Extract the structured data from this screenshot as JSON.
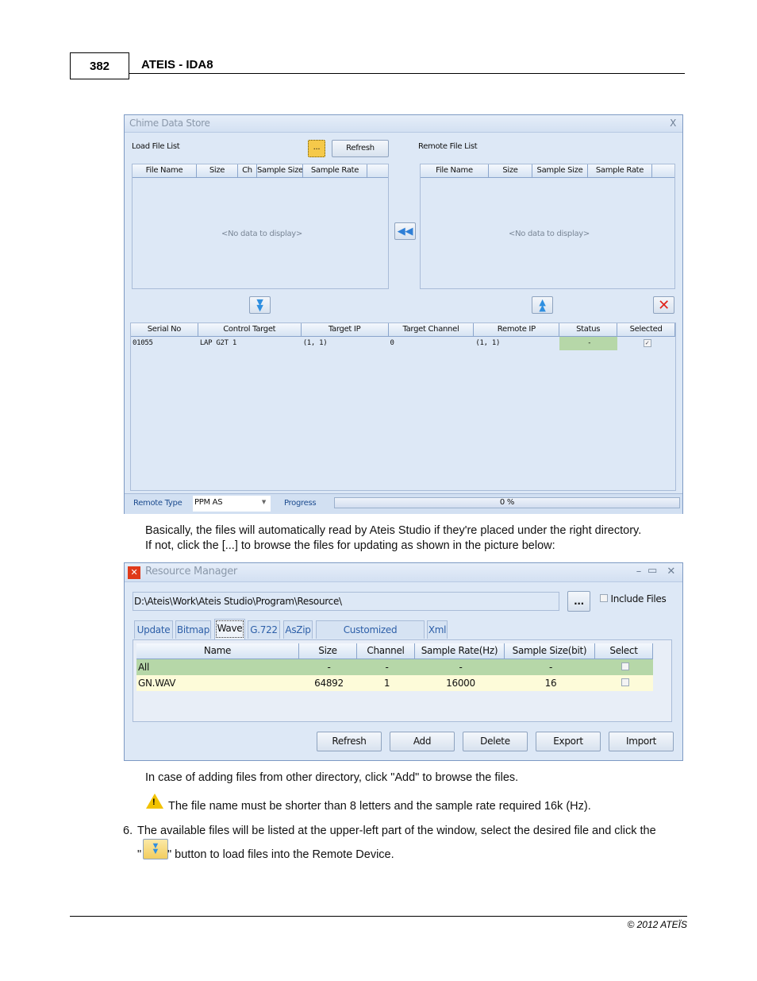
{
  "page": {
    "number": "382",
    "title": "ATEIS - IDA8",
    "copyright": "© 2012 ATEÏS"
  },
  "chime": {
    "title": "Chime Data Store",
    "close": "X",
    "load_label": "Load File List",
    "browse_label": "...",
    "refresh_label": "Refresh",
    "remote_label": "Remote File List",
    "load_columns": [
      "File Name",
      "Size",
      "Ch",
      "Sample Size",
      "Sample Rate"
    ],
    "remote_columns": [
      "File Name",
      "Size",
      "Sample Size",
      "Sample Rate"
    ],
    "no_data": "<No data to display>",
    "device_columns": [
      "Serial No",
      "Control Target",
      "Target IP",
      "Target Channel",
      "Remote IP",
      "Status",
      "Selected"
    ],
    "device_rows": [
      {
        "serial": "01055",
        "control": "LAP G2T 1",
        "target_ip": "(1, 1)",
        "channel": "0",
        "remote_ip": "(1, 1)",
        "status": "-",
        "selected": true
      }
    ],
    "remote_type_label": "Remote Type",
    "remote_type_value": "PPM AS",
    "progress_label": "Progress",
    "progress_text": "0 %",
    "progress_percent": 0,
    "status_color": "#b6d7a8"
  },
  "text1": "Basically, the files will automatically read by Ateis Studio if they're placed under the right directory.",
  "text2": "If not, click the [...] to browse the files for updating as shown in the picture below:",
  "resource": {
    "title": "Resource Manager",
    "path": "D:\\Ateis\\Work\\Ateis Studio\\Program\\Resource\\",
    "browse_label": "...",
    "include_files": "Include Files",
    "tabs": [
      "Update",
      "Bitmap",
      "Wave",
      "G.722",
      "AsZip",
      "Customized Component",
      "Xml"
    ],
    "active_tab": "Wave",
    "columns": [
      "Name",
      "Size",
      "Channel",
      "Sample Rate(Hz)",
      "Sample Size(bit)",
      "Select"
    ],
    "rows": [
      [
        "All",
        "-",
        "-",
        "-",
        "-"
      ],
      [
        "GN.WAV",
        "64892",
        "1",
        "16000",
        "16"
      ]
    ],
    "buttons": [
      "Refresh",
      "Add",
      "Delete",
      "Export",
      "Import"
    ]
  },
  "text3": "In case of adding files from other directory, click \"Add\" to browse the files.",
  "warning": "The file name must be shorter than 8 letters and the sample rate required 16k (Hz).",
  "step6_num": "6.",
  "step6_line1": "The available files will be listed at the upper-left part of the window, select the desired file and click the",
  "step6_quote_open": "\"",
  "step6_line2": "\" button to load files into the Remote Device."
}
